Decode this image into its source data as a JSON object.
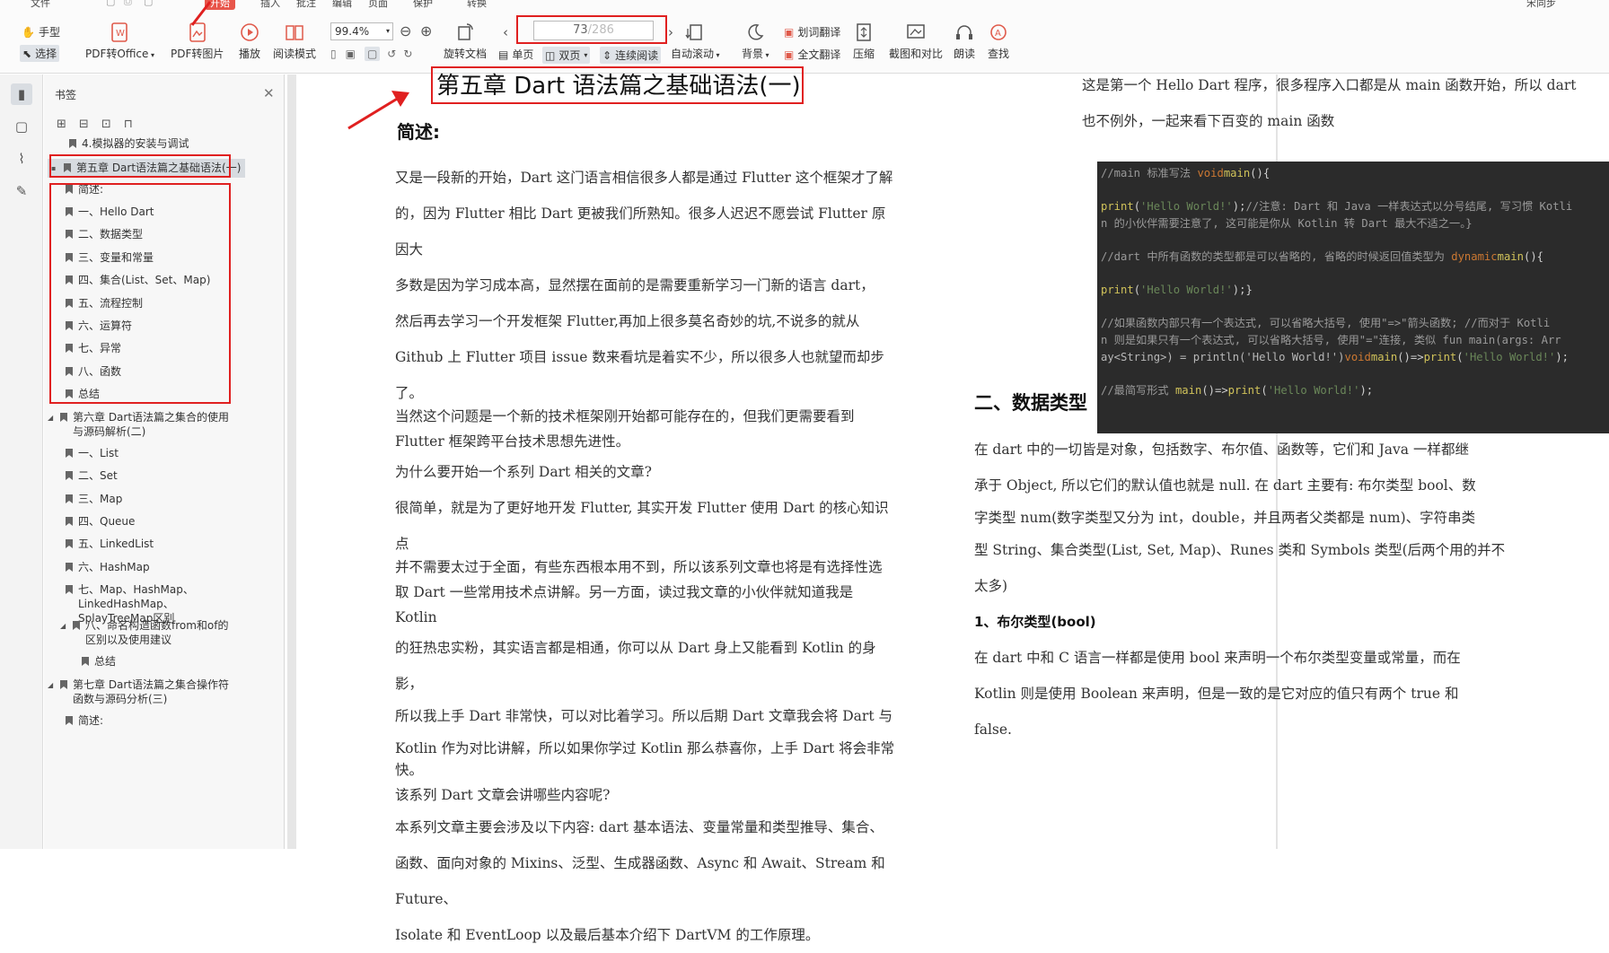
{
  "menubar": {
    "items": [
      "文件",
      "",
      "",
      "",
      "开始",
      "插入",
      "批注",
      "编辑",
      "页面",
      "保护",
      "转换"
    ],
    "active": "开始",
    "user": "宋同步"
  },
  "toolbar": {
    "hand": "手型",
    "select": "选择",
    "pdf_to_office": "PDF转Office",
    "pdf_to_image": "PDF转图片",
    "play": "播放",
    "read_mode": "阅读模式",
    "zoom_value": "99.4%",
    "rotate": "旋转文档",
    "single_page": "单页",
    "double_page": "双页",
    "continuous": "连续阅读",
    "page_current": "73",
    "page_total": "286",
    "auto_scroll": "自动滚动",
    "background": "背景",
    "word_translate": "划词翻译",
    "full_translate": "全文翻译",
    "compress": "压缩",
    "screenshot_compare": "截图和对比",
    "read_aloud": "朗读",
    "find": "查找"
  },
  "panel": {
    "title": "书签",
    "items": [
      {
        "label": "4.模拟器的安装与调试",
        "level": 1,
        "tri": ""
      },
      {
        "label": "第五章 Dart语法篇之基础语法(一)",
        "level": 0,
        "tri": "▪",
        "selected": true
      },
      {
        "label": "简述:",
        "level": 1,
        "tri": ""
      },
      {
        "label": "一、Hello Dart",
        "level": 1,
        "tri": ""
      },
      {
        "label": "二、数据类型",
        "level": 1,
        "tri": ""
      },
      {
        "label": "三、变量和常量",
        "level": 1,
        "tri": ""
      },
      {
        "label": "四、集合(List、Set、Map)",
        "level": 1,
        "tri": ""
      },
      {
        "label": "五、流程控制",
        "level": 1,
        "tri": ""
      },
      {
        "label": "六、运算符",
        "level": 1,
        "tri": ""
      },
      {
        "label": "七、异常",
        "level": 1,
        "tri": ""
      },
      {
        "label": "八、函数",
        "level": 1,
        "tri": ""
      },
      {
        "label": "总结",
        "level": 1,
        "tri": ""
      },
      {
        "label": "第六章 Dart语法篇之集合的使用与源码解析(二)",
        "level": 0,
        "tri": "◢"
      },
      {
        "label": "一、List",
        "level": 1,
        "tri": ""
      },
      {
        "label": "二、Set",
        "level": 1,
        "tri": ""
      },
      {
        "label": "三、Map",
        "level": 1,
        "tri": ""
      },
      {
        "label": "四、Queue",
        "level": 1,
        "tri": ""
      },
      {
        "label": "五、LinkedList",
        "level": 1,
        "tri": ""
      },
      {
        "label": "六、HashMap",
        "level": 1,
        "tri": ""
      },
      {
        "label": "七、Map、HashMap、LinkedHashMap、SplayTreeMap区别",
        "level": 1,
        "tri": ""
      },
      {
        "label": "八、命名构造函数from和of的区别以及使用建议",
        "level": 1,
        "tri": "◢"
      },
      {
        "label": "总结",
        "level": 2,
        "tri": ""
      },
      {
        "label": "第七章 Dart语法篇之集合操作符函数与源码分析(三)",
        "level": 0,
        "tri": "◢"
      },
      {
        "label": "简述:",
        "level": 1,
        "tri": ""
      }
    ]
  },
  "left_page": {
    "chapter_title": "第五章  Dart 语法篇之基础语法(一)",
    "section": "简述:",
    "paragraphs": [
      "又是一段新的开始，Dart 这门语言相信很多人都是通过 Flutter 这个框架才了解",
      "的，因为 Flutter 相比 Dart 更被我们所熟知。很多人迟迟不愿尝试 Flutter 原因大",
      "多数是因为学习成本高，显然摆在面前的是需要重新学习一门新的语言 dart，",
      "然后再去学习一个开发框架 Flutter,再加上很多莫名奇妙的坑,不说多的就从",
      "Github 上 Flutter 项目 issue 数来看坑是着实不少，所以很多人也就望而却步了。",
      "当然这个问题是一个新的技术框架刚开始都可能存在的，但我们更需要看到",
      "Flutter 框架跨平台技术思想先进性。",
      "为什么要开始一个系列 Dart 相关的文章?",
      "很简单，就是为了更好地开发 Flutter, 其实开发 Flutter 使用 Dart 的核心知识点",
      "并不需要太过于全面，有些东西根本用不到，所以该系列文章也将是有选择性选",
      "取 Dart 一些常用技术点讲解。另一方面，读过我文章的小伙伴就知道我是 Kotlin",
      "的狂热忠实粉，其实语言都是相通，你可以从 Dart 身上又能看到 Kotlin 的身影，",
      "所以我上手 Dart 非常快，可以对比着学习。所以后期 Dart 文章我会将 Dart 与",
      "Kotlin 作为对比讲解，所以如果你学过 Kotlin 那么恭喜你，上手 Dart 将会非常",
      "快。",
      "该系列 Dart 文章会讲哪些内容呢?",
      "本系列文章主要会涉及以下内容: dart 基本语法、变量常量和类型推导、集合、",
      "函数、面向对象的 Mixins、泛型、生成器函数、Async 和 Await、Stream 和 Future、",
      "Isolate 和 EventLoop 以及最后基本介绍下 DartVM 的工作原理。"
    ]
  },
  "right_page": {
    "intro_1": "这是第一个 Hello Dart 程序，很多程序入口都是从 main 函数开始，所以 dart",
    "intro_2": "也不例外，一起来看下百变的 main 函数",
    "code": {
      "l1a": "//main 标准写法 ",
      "l1b": "void",
      "l1c": "main",
      "l1d": "(){",
      "l2a": "print",
      "l2b": "(",
      "l2c": "'Hello World!'",
      "l2d": ");",
      "l2e": "//注意: Dart 和 Java 一样表达式以分号结尾, 写习惯 Kotli",
      "l3": "n 的小伙伴需要注意了, 这可能是你从 Kotlin 转 Dart 最大不适之一。}",
      "l4a": "//dart 中所有函数的类型都是可以省略的, 省略的时候返回值类型为 ",
      "l4b": "dynamic",
      "l4c": "main",
      "l4d": "(){",
      "l5a": "print",
      "l5b": "(",
      "l5c": "'Hello World!'",
      "l5d": ");}",
      "l6": "//如果函数内部只有一个表达式, 可以省略大括号, 使用\"=>\"箭头函数; //而对于 Kotli",
      "l7": "n 则是如果只有一个表达式, 可以省略大括号, 使用\"=\"连接, 类似 fun main(args: Arr",
      "l8a": "ay<String>) = println('Hello World!')",
      "l8b": "void",
      "l8c": "main",
      "l8d": "()=>",
      "l8e": "print",
      "l8f": "(",
      "l8g": "'Hello World!'",
      "l8h": ");",
      "l9a": "//最简写形式 ",
      "l9b": "main",
      "l9c": "()=>",
      "l9d": "print",
      "l9e": "(",
      "l9f": "'Hello World!'",
      "l9g": ");"
    },
    "section_2": "二、数据类型",
    "p1": "在 dart 中的一切皆是对象，包括数字、布尔值、函数等，它们和 Java 一样都继",
    "p2": "承于 Object, 所以它们的默认值也就是 null. 在 dart 主要有: 布尔类型 bool、数",
    "p3": "字类型 num(数字类型又分为 int，double，并且两者父类都是 num)、字符串类",
    "p4": "型 String、集合类型(List, Set, Map)、Runes 类和 Symbols 类型(后两个用的并不",
    "p5": "太多)",
    "sub_1": "1、布尔类型(bool)",
    "q1": "在 dart 中和 C 语言一样都是使用 bool 来声明一个布尔类型变量或常量，而在",
    "q2": "Kotlin 则是使用 Boolean 来声明，但是一致的是它对应的值只有两个 true 和",
    "q3": "false."
  },
  "colors": {
    "annotation_red": "#e02020",
    "code_bg": "#2b2b2b",
    "menu_active": "#e8564b"
  }
}
